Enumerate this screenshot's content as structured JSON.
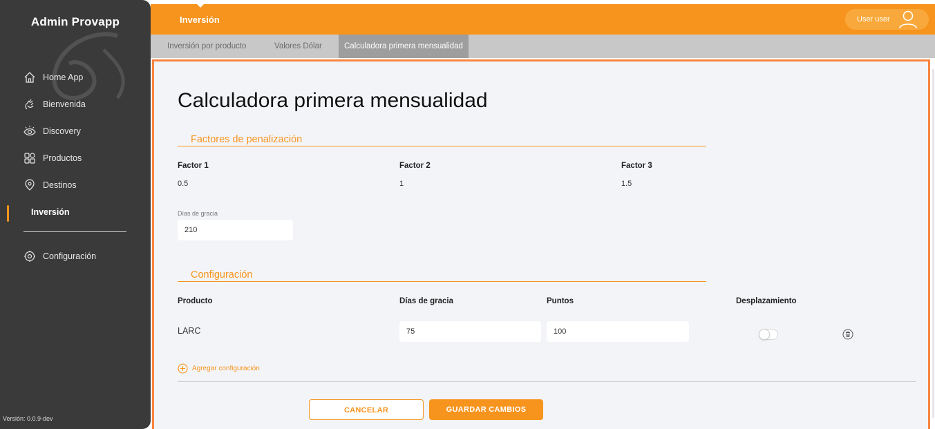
{
  "sidebar": {
    "brand": "Admin Provapp",
    "items": [
      {
        "label": "Home App",
        "icon": "home-icon"
      },
      {
        "label": "Bienvenida",
        "icon": "wave-hand-icon"
      },
      {
        "label": "Discovery",
        "icon": "eye-icon"
      },
      {
        "label": "Productos",
        "icon": "grid-icon"
      },
      {
        "label": "Destinos",
        "icon": "location-pin-icon"
      },
      {
        "label": "Inversión",
        "icon": ""
      },
      {
        "label": "Configuración",
        "icon": "gear-icon"
      }
    ],
    "active_item": "Inversión",
    "version": "Versión: 0.0.9-dev"
  },
  "header": {
    "title": "Inversión",
    "user_label": "User user",
    "user_icon": "user-icon"
  },
  "tabs": [
    {
      "label": "Inversión por producto"
    },
    {
      "label": "Valores Dólar"
    },
    {
      "label": "Calculadora primera mensualidad"
    }
  ],
  "active_tab": "Calculadora primera mensualidad",
  "main": {
    "title": "Calculadora primera mensualidad",
    "penalty_section": {
      "title": "Factores de penalización",
      "factors": [
        {
          "label": "Factor 1",
          "value": "0.5"
        },
        {
          "label": "Factor 2",
          "value": "1"
        },
        {
          "label": "Factor 3",
          "value": "1.5"
        }
      ],
      "grace_days_label": "Días de gracia",
      "grace_days_value": "210"
    },
    "config_section": {
      "title": "Configuración",
      "columns": [
        "Producto",
        "Días de gracia",
        "Puntos",
        "Desplazamiento"
      ],
      "rows": [
        {
          "product": "LARC",
          "grace_days": "75",
          "points": "100",
          "displacement": false
        }
      ],
      "add_label": "Agregar configuración"
    },
    "buttons": {
      "cancel": "CANCELAR",
      "save": "GUARDAR CAMBIOS"
    }
  },
  "colors": {
    "accent": "#f7941d",
    "sidebar_bg": "#3a3a3a",
    "tab_bar_bg": "#c8c8c8",
    "active_tab_bg": "#9e9e9e",
    "content_bg": "#f3f4f8"
  }
}
